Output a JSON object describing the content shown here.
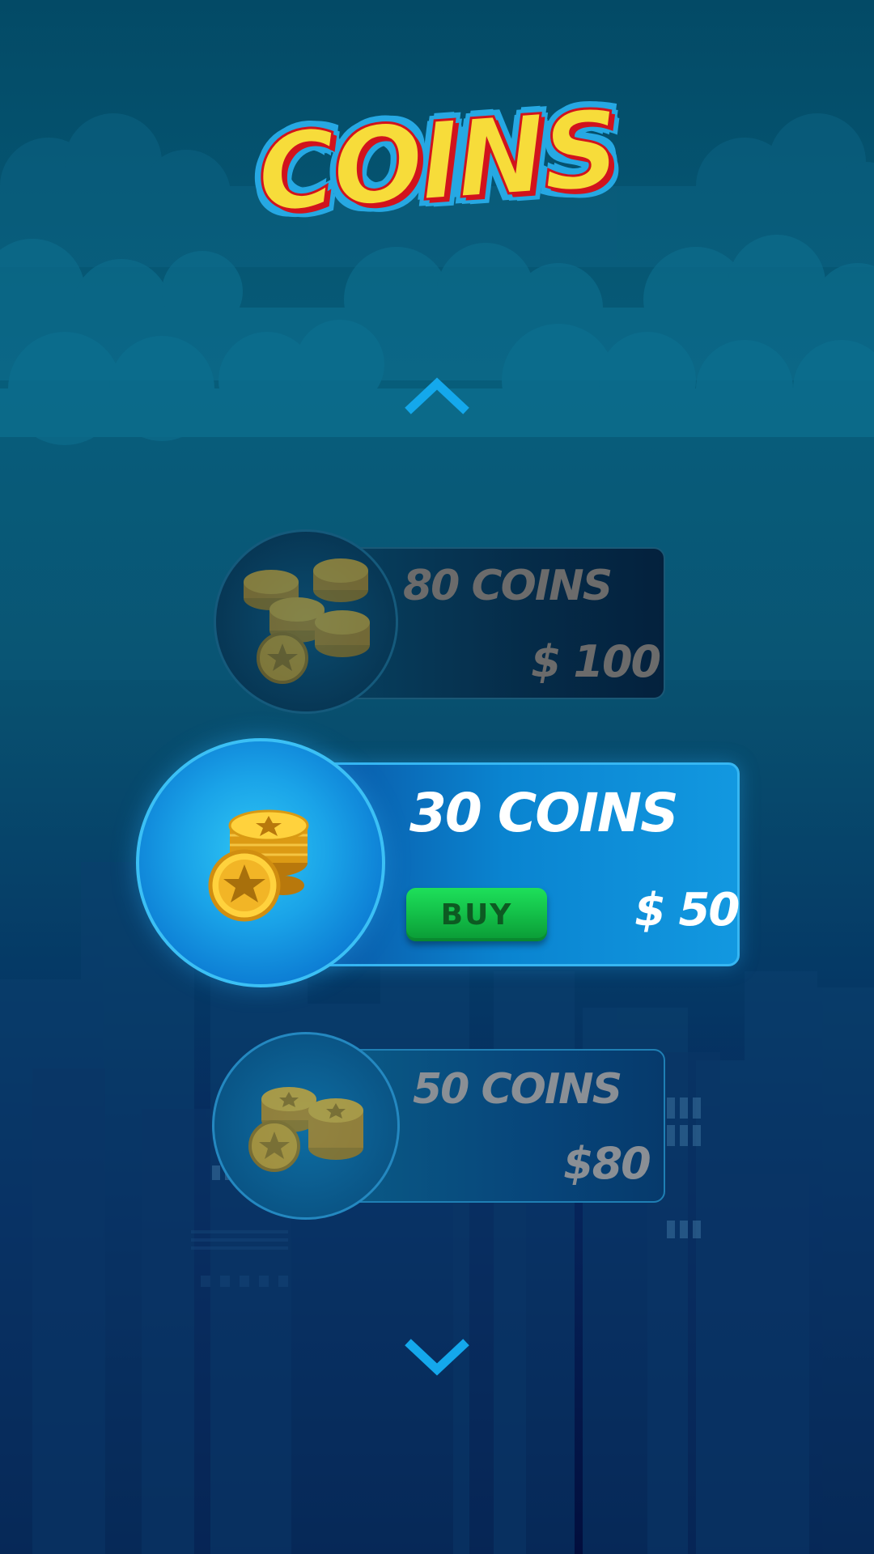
{
  "title": "COINS",
  "nav": {
    "scroll_up_icon": "chevron-up-icon",
    "scroll_down_icon": "chevron-down-icon"
  },
  "packs": [
    {
      "amount_label": "80 COINS",
      "price": "$ 100",
      "state": "dimmed"
    },
    {
      "amount_label": "30 COINS",
      "price": "$ 50",
      "state": "selected",
      "buy_label": "BUY"
    },
    {
      "amount_label": "50 COINS",
      "price": "$80",
      "state": "dimmed"
    }
  ],
  "colors": {
    "title_fill": "#f7dc3a",
    "title_outline": "#26a8e3",
    "title_shadow": "#d1131d",
    "accent_blue": "#1aa3e8",
    "buy_green": "#14c24a",
    "arrow_blue": "#14a8ec"
  }
}
